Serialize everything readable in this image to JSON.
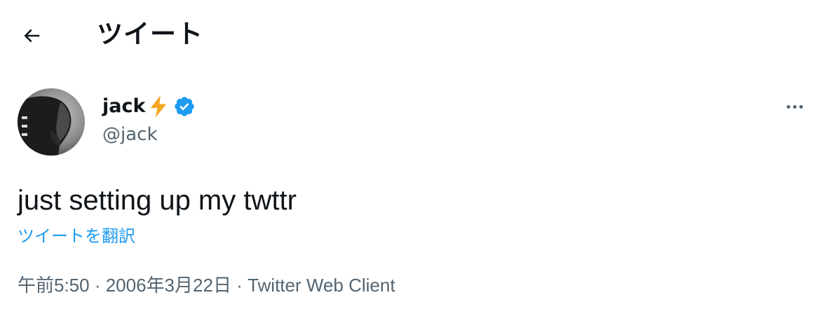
{
  "header": {
    "title": "ツイート",
    "back_icon": "arrow-left-icon"
  },
  "author": {
    "display_name": "jack",
    "emoji": "⚡",
    "handle": "@jack",
    "verified": true,
    "verified_color": "#1d9bf0"
  },
  "tweet": {
    "text": "just setting up my twttr",
    "translate_label": "ツイートを翻訳"
  },
  "meta": {
    "time": "午前5:50",
    "separator": " · ",
    "date": "2006年3月22日",
    "source": "Twitter Web Client"
  },
  "colors": {
    "text_primary": "#0f1419",
    "text_secondary": "#536471",
    "link": "#1d9bf0"
  }
}
